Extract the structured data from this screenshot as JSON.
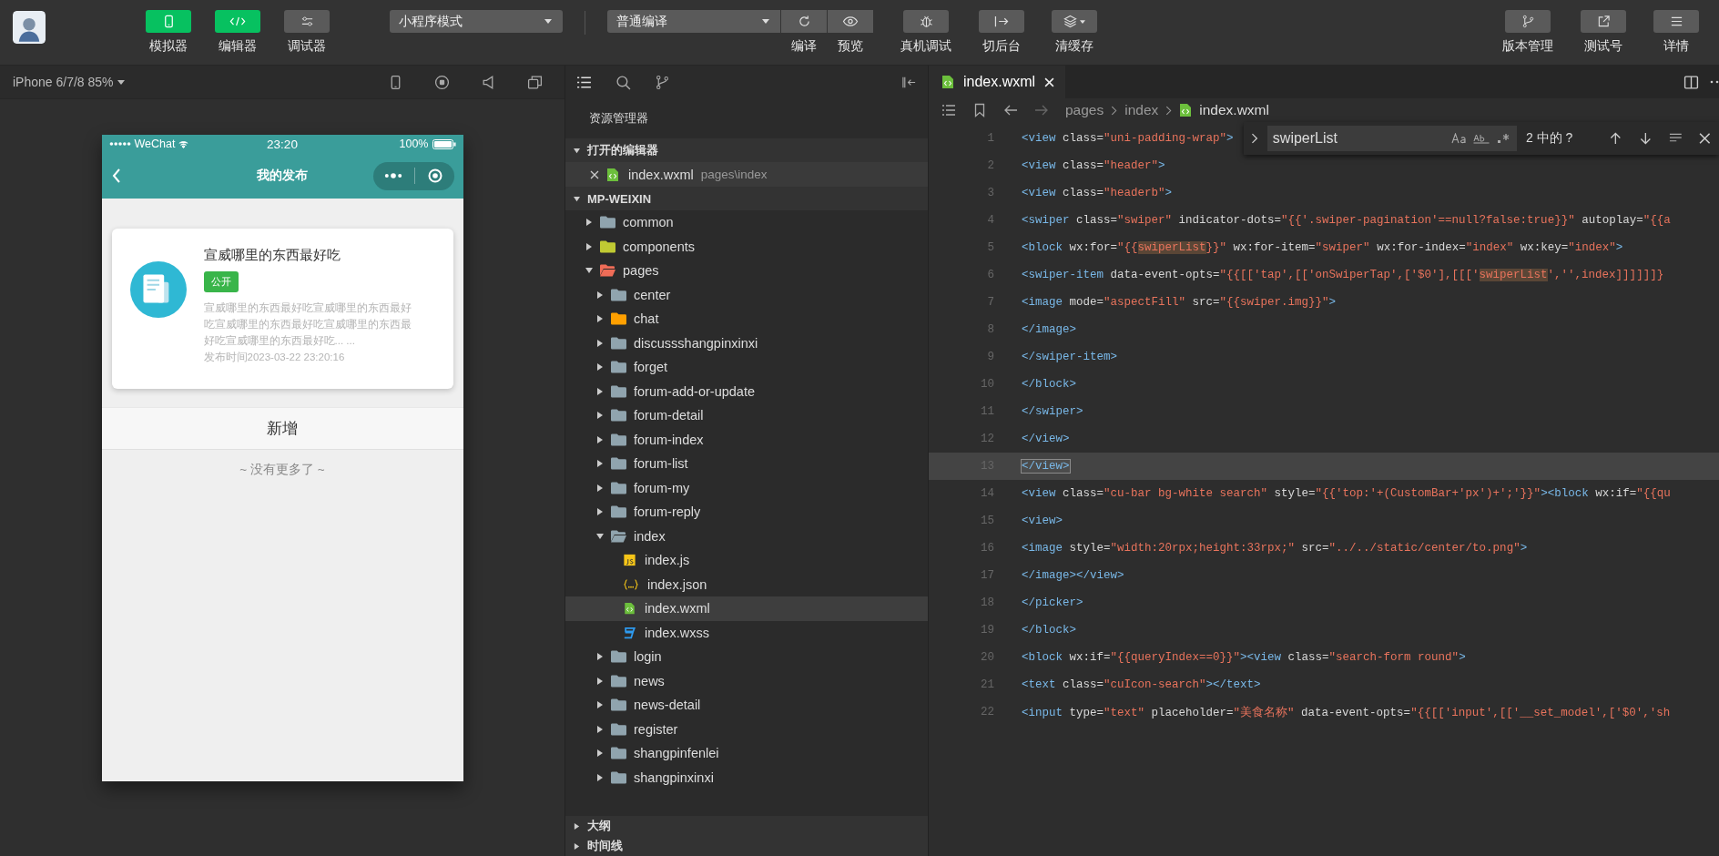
{
  "toolbar": {
    "left_buttons": [
      {
        "label": "模拟器",
        "kind": "phone",
        "on": true
      },
      {
        "label": "编辑器",
        "kind": "code",
        "on": true
      },
      {
        "label": "调试器",
        "kind": "sliders",
        "on": false
      }
    ],
    "mode_select": "小程序模式",
    "compile": {
      "select": "普通编译",
      "actions": [
        {
          "label": "编译",
          "kind": "refresh"
        },
        {
          "label": "预览",
          "kind": "eye"
        }
      ]
    },
    "tools": [
      {
        "label": "真机调试",
        "kind": "bug",
        "menu": false
      },
      {
        "label": "切后台",
        "kind": "exit",
        "menu": false
      },
      {
        "label": "清缓存",
        "kind": "layers",
        "menu": true
      }
    ],
    "right_buttons": [
      {
        "label": "版本管理",
        "kind": "branch"
      },
      {
        "label": "测试号",
        "kind": "share"
      },
      {
        "label": "详情",
        "kind": "menu"
      }
    ]
  },
  "simulator": {
    "device": "iPhone 6/7/8 85%",
    "phone": {
      "carrier": "WeChat",
      "time": "23:20",
      "battery": "100%",
      "title": "我的发布",
      "posts": [
        {
          "title": "宣威哪里的东西最好吃",
          "tag": "公开",
          "summary": "宣威哪里的东西最好吃宣威哪里的东西最好吃宣威哪里的东西最好吃宣威哪里的东西最好吃宣威哪里的东西最好吃... ...",
          "time": "发布时间2023-03-22 23:20:16"
        }
      ],
      "add_button": "新增",
      "end_note": "~ 没有更多了 ~"
    }
  },
  "explorer": {
    "title": "资源管理器",
    "open_editors": {
      "label": "打开的编辑器",
      "expanded": true,
      "items": [
        {
          "name": "index.wxml",
          "path": "pages\\index",
          "kind": "wxml"
        }
      ]
    },
    "project": {
      "label": "MP-WEIXIN",
      "expanded": true,
      "tree": [
        {
          "name": "common",
          "kind": "folder",
          "color": "#90a4ae",
          "expanded": false,
          "selected": false
        },
        {
          "name": "components",
          "kind": "folder",
          "color": "#c0ca33",
          "expanded": false,
          "selected": false
        },
        {
          "name": "pages",
          "kind": "folder",
          "color": "#ef6c57",
          "expanded": true,
          "selected": false,
          "children": [
            {
              "name": "center",
              "kind": "folder",
              "color": "#90a4ae",
              "expanded": false,
              "selected": false
            },
            {
              "name": "chat",
              "kind": "folder",
              "color": "#ffa000",
              "expanded": false,
              "selected": false
            },
            {
              "name": "discussshangpinxinxi",
              "kind": "folder",
              "color": "#90a4ae",
              "expanded": false,
              "selected": false
            },
            {
              "name": "forget",
              "kind": "folder",
              "color": "#90a4ae",
              "expanded": false,
              "selected": false
            },
            {
              "name": "forum-add-or-update",
              "kind": "folder",
              "color": "#90a4ae",
              "expanded": false,
              "selected": false
            },
            {
              "name": "forum-detail",
              "kind": "folder",
              "color": "#90a4ae",
              "expanded": false,
              "selected": false
            },
            {
              "name": "forum-index",
              "kind": "folder",
              "color": "#90a4ae",
              "expanded": false,
              "selected": false
            },
            {
              "name": "forum-list",
              "kind": "folder",
              "color": "#90a4ae",
              "expanded": false,
              "selected": false
            },
            {
              "name": "forum-my",
              "kind": "folder",
              "color": "#90a4ae",
              "expanded": false,
              "selected": false
            },
            {
              "name": "forum-reply",
              "kind": "folder",
              "color": "#90a4ae",
              "expanded": false,
              "selected": false
            },
            {
              "name": "index",
              "kind": "folder",
              "color": "#90a4ae",
              "expanded": true,
              "selected": false,
              "children": [
                {
                  "name": "index.js",
                  "kind": "js",
                  "selected": false
                },
                {
                  "name": "index.json",
                  "kind": "json",
                  "selected": false
                },
                {
                  "name": "index.wxml",
                  "kind": "wxml",
                  "selected": true
                },
                {
                  "name": "index.wxss",
                  "kind": "wxss",
                  "selected": false
                }
              ]
            },
            {
              "name": "login",
              "kind": "folder",
              "color": "#90a4ae",
              "expanded": false,
              "selected": false
            },
            {
              "name": "news",
              "kind": "folder",
              "color": "#90a4ae",
              "expanded": false,
              "selected": false
            },
            {
              "name": "news-detail",
              "kind": "folder",
              "color": "#90a4ae",
              "expanded": false,
              "selected": false
            },
            {
              "name": "register",
              "kind": "folder",
              "color": "#90a4ae",
              "expanded": false,
              "selected": false
            },
            {
              "name": "shangpinfenlei",
              "kind": "folder",
              "color": "#90a4ae",
              "expanded": false,
              "selected": false
            },
            {
              "name": "shangpinxinxi",
              "kind": "folder",
              "color": "#90a4ae",
              "expanded": false,
              "selected": false
            }
          ]
        }
      ]
    },
    "sections": [
      {
        "label": "大纲",
        "expanded": false
      },
      {
        "label": "时间线",
        "expanded": false
      }
    ]
  },
  "editor": {
    "tabs": [
      {
        "name": "index.wxml",
        "selected": true
      }
    ],
    "breadcrumb": [
      "pages",
      "index",
      "index.wxml"
    ],
    "find": {
      "query": "swiperList",
      "result": "2 中的 ?"
    },
    "lines": [
      {
        "number": "1",
        "current": false,
        "parts": [
          {
            "text": "<view class=\"uni-padding-wrap\">"
          }
        ]
      },
      {
        "number": "2",
        "current": false,
        "parts": [
          {
            "text": "<view class=\"header\">"
          }
        ]
      },
      {
        "number": "3",
        "current": false,
        "parts": [
          {
            "text": "<view class=\"headerb\">"
          }
        ]
      },
      {
        "number": "4",
        "current": false,
        "parts": [
          {
            "text": "<swiper class=\"swiper\" indicator-dots=\"{{'.swiper-pagination'==null?false:true}}\" autoplay=\"{{a"
          }
        ]
      },
      {
        "number": "5",
        "current": false,
        "parts": [
          {
            "text": "<block wx:for=\"{{"
          },
          {
            "text": "swiperList",
            "match": true
          },
          {
            "text": "}}\" wx:for-item=\"swiper\" wx:for-index=\"index\" wx:key=\"index\">"
          }
        ]
      },
      {
        "number": "6",
        "current": false,
        "parts": [
          {
            "text": "<swiper-item data-event-opts=\"{{[['tap',[['onSwiperTap',['$0'],[[['"
          },
          {
            "text": "swiperList",
            "match": true
          },
          {
            "text": "','',index]]]]]]}"
          }
        ]
      },
      {
        "number": "7",
        "current": false,
        "parts": [
          {
            "text": "<image mode=\"aspectFill\" src=\"{{swiper.img}}\">"
          }
        ]
      },
      {
        "number": "8",
        "current": false,
        "parts": [
          {
            "text": "</image>"
          }
        ]
      },
      {
        "number": "9",
        "current": false,
        "parts": [
          {
            "text": "</swiper-item>"
          }
        ]
      },
      {
        "number": "10",
        "current": false,
        "parts": [
          {
            "text": "</block>"
          }
        ]
      },
      {
        "number": "11",
        "current": false,
        "parts": [
          {
            "text": "</swiper>"
          }
        ]
      },
      {
        "number": "12",
        "current": false,
        "parts": [
          {
            "text": "</view>"
          }
        ]
      },
      {
        "number": "13",
        "current": true,
        "parts": [
          {
            "text": "</view>"
          }
        ]
      },
      {
        "number": "14",
        "current": false,
        "parts": [
          {
            "text": "<view class=\"cu-bar bg-white search\" style=\"{{'top:'+(CustomBar+'px')+';'}}\"><block wx:if=\"{{qu"
          }
        ]
      },
      {
        "number": "15",
        "current": false,
        "parts": [
          {
            "text": "<view>"
          }
        ]
      },
      {
        "number": "16",
        "current": false,
        "parts": [
          {
            "text": "<image style=\"width:20rpx;height:33rpx;\" src=\"../../static/center/to.png\">"
          }
        ]
      },
      {
        "number": "17",
        "current": false,
        "parts": [
          {
            "text": "</image></view>"
          }
        ]
      },
      {
        "number": "18",
        "current": false,
        "parts": [
          {
            "text": "</picker>"
          }
        ]
      },
      {
        "number": "19",
        "current": false,
        "parts": [
          {
            "text": "</block>"
          }
        ]
      },
      {
        "number": "20",
        "current": false,
        "parts": [
          {
            "text": "<block wx:if=\"{{queryIndex==0}}\"><view class=\"search-form round\">"
          }
        ]
      },
      {
        "number": "21",
        "current": false,
        "parts": [
          {
            "text": "<text class=\"cuIcon-search\"></text>"
          }
        ]
      },
      {
        "number": "22",
        "current": false,
        "parts": [
          {
            "text": "<input type=\"text\" placeholder=\"美食名称\" data-event-opts=\"{{[['input',[['__set_model',['$0','sh"
          }
        ]
      }
    ]
  }
}
